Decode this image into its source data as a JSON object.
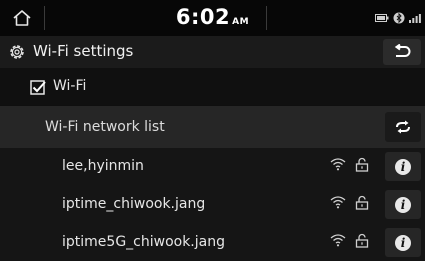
{
  "status": {
    "time": "6:02",
    "ampm": "AM",
    "icons": [
      "battery-icon",
      "bluetooth-icon",
      "signal-icon"
    ]
  },
  "title_bar": {
    "title": "Wi-Fi settings",
    "icon": "gear-icon",
    "back_icon": "back-arrow-icon"
  },
  "wifi_toggle": {
    "label": "Wi-Fi",
    "checked": true
  },
  "network_list": {
    "header": "Wi-Fi network list",
    "refresh_icon": "refresh-icon",
    "networks": [
      {
        "name": "lee,hyinmin",
        "secured": true,
        "signal": "full"
      },
      {
        "name": "iptime_chiwook.jang",
        "secured": true,
        "signal": "full"
      },
      {
        "name": "iptime5G_chiwook.jang",
        "secured": true,
        "signal": "full"
      }
    ]
  }
}
